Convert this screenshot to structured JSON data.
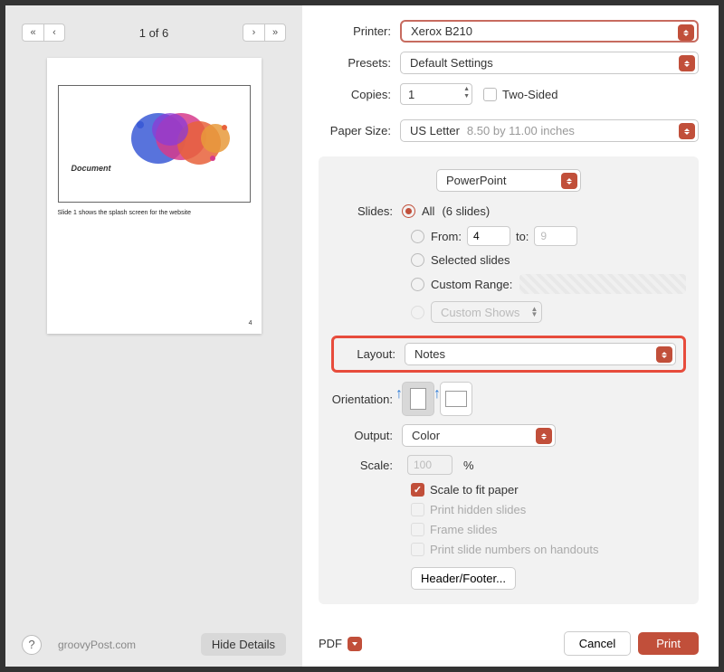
{
  "nav": {
    "page_counter": "1 of 6"
  },
  "preview": {
    "slide_label": "Document",
    "caption": "Slide 1 shows the splash screen for the website",
    "page_num": "4"
  },
  "left_footer": {
    "watermark": "groovyPost.com",
    "hide_details": "Hide Details"
  },
  "printer": {
    "label": "Printer:",
    "value": "Xerox B210"
  },
  "presets": {
    "label": "Presets:",
    "value": "Default Settings"
  },
  "copies": {
    "label": "Copies:",
    "value": "1",
    "two_sided": "Two-Sided"
  },
  "paper_size": {
    "label": "Paper Size:",
    "value": "US Letter",
    "dims": "8.50 by 11.00 inches"
  },
  "app_section": "PowerPoint",
  "slides": {
    "label": "Slides:",
    "all": "All",
    "all_count": "(6 slides)",
    "from": "From:",
    "from_val": "4",
    "to": "to:",
    "to_val": "9",
    "selected": "Selected slides",
    "custom_range": "Custom Range:",
    "custom_shows": "Custom Shows"
  },
  "layout": {
    "label": "Layout:",
    "value": "Notes"
  },
  "orientation": {
    "label": "Orientation:"
  },
  "output": {
    "label": "Output:",
    "value": "Color"
  },
  "scale": {
    "label": "Scale:",
    "value": "100",
    "pct": "%"
  },
  "checks": {
    "fit": "Scale to fit paper",
    "hidden": "Print hidden slides",
    "frame": "Frame slides",
    "numbers": "Print slide numbers on handouts"
  },
  "header_footer": "Header/Footer...",
  "footer": {
    "pdf": "PDF",
    "cancel": "Cancel",
    "print": "Print"
  }
}
